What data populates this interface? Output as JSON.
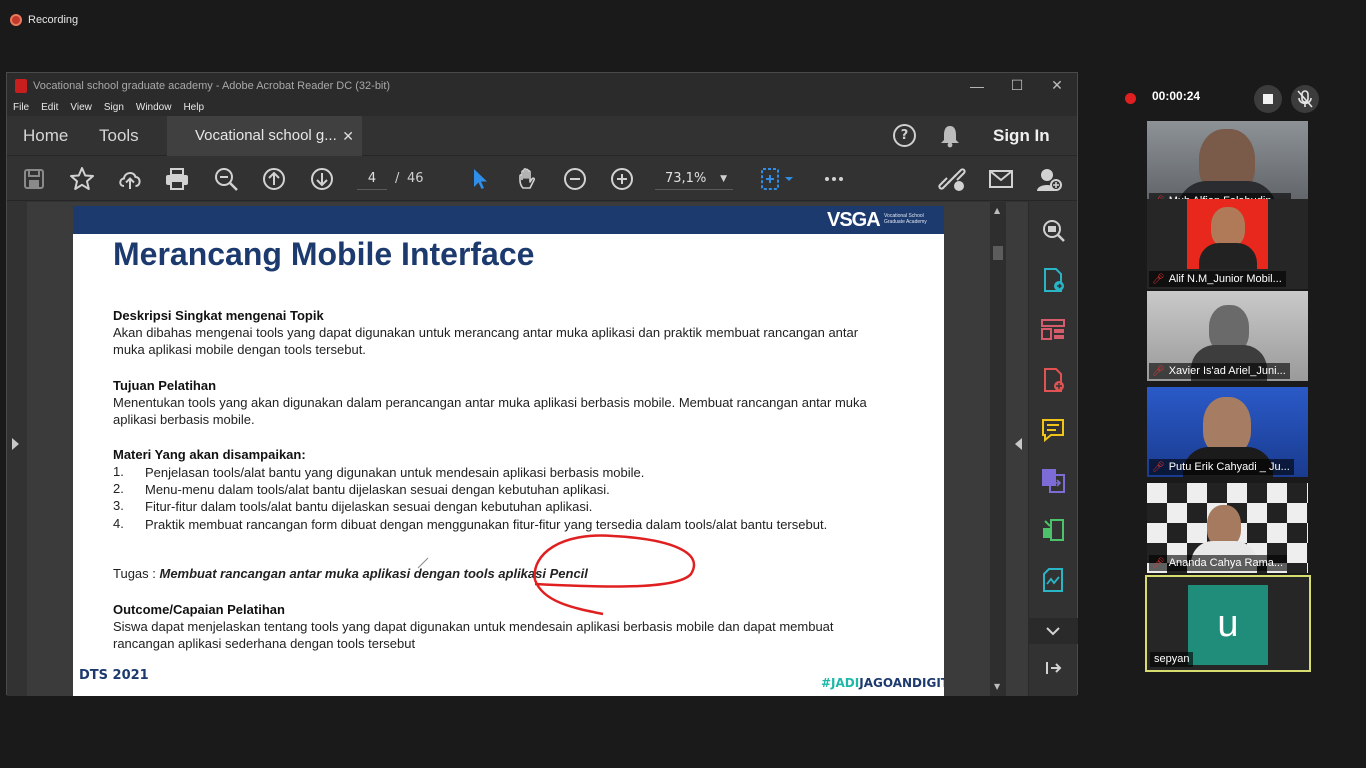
{
  "recording": {
    "label": "Recording"
  },
  "acrobat": {
    "window_title": "Vocational school graduate academy - Adobe Acrobat Reader DC (32-bit)",
    "menu": [
      "File",
      "Edit",
      "View",
      "Sign",
      "Window",
      "Help"
    ],
    "tabs": {
      "home": "Home",
      "tools": "Tools",
      "document": "Vocational school g..."
    },
    "sign_in": "Sign In",
    "page_current": "4",
    "page_separator": "/",
    "page_total": "46",
    "zoom": "73,1%",
    "accent_color": "#2f8ee8"
  },
  "slide": {
    "logo": "VSGA",
    "logo_sub": "Vocational School Graduate Academy",
    "title": "Merancang Mobile Interface",
    "sections": {
      "deskripsi_h": "Deskripsi Singkat mengenai Topik",
      "deskripsi_p": "Akan dibahas mengenai tools yang dapat digunakan untuk merancang antar muka aplikasi dan praktik membuat rancangan antar muka aplikasi mobile dengan tools tersebut.",
      "tujuan_h": "Tujuan Pelatihan",
      "tujuan_p": "Menentukan tools yang akan digunakan dalam perancangan antar muka aplikasi berbasis mobile. Membuat rancangan antar muka aplikasi berbasis mobile.",
      "materi_h": "Materi Yang akan disampaikan:",
      "materi_items": [
        {
          "n": "1.",
          "t": "Penjelasan tools/alat bantu yang digunakan untuk mendesain aplikasi berbasis mobile."
        },
        {
          "n": "2.",
          "t": "Menu-menu dalam tools/alat bantu dijelaskan sesuai dengan kebutuhan aplikasi."
        },
        {
          "n": "3.",
          "t": "Fitur-fitur dalam tools/alat bantu dijelaskan sesuai dengan kebutuhan aplikasi."
        },
        {
          "n": "4.",
          "t": "Praktik membuat rancangan form dibuat dengan menggunakan fitur-fitur yang tersedia dalam tools/alat bantu tersebut."
        }
      ],
      "tugas_label": "Tugas : ",
      "tugas_text": "Membuat rancangan antar muka aplikasi dengan tools aplikasi Pencil",
      "outcome_h": "Outcome/Capaian Pelatihan",
      "outcome_p": "Siswa dapat menjelaskan tentang tools yang dapat digunakan untuk mendesain aplikasi berbasis mobile dan dapat membuat rancangan aplikasi sederhana dengan tools tersebut"
    },
    "footer_left": "DTS 2021",
    "footer_right_a": "#JADI",
    "footer_right_b": "JAGOANDIGITAL",
    "annotation_color": "#e02020"
  },
  "call": {
    "timer": "00:00:24",
    "participants": [
      {
        "name": "Muh Alfian Falahudin_..."
      },
      {
        "name": "Alif N.M_Junior Mobil..."
      },
      {
        "name": "Xavier Is'ad Ariel_Juni..."
      },
      {
        "name": "Putu Erik Cahyadi _ Ju..."
      },
      {
        "name": "Ananda Cahya Rama..."
      }
    ],
    "self": {
      "initial": "u",
      "name": "sepyan"
    }
  }
}
